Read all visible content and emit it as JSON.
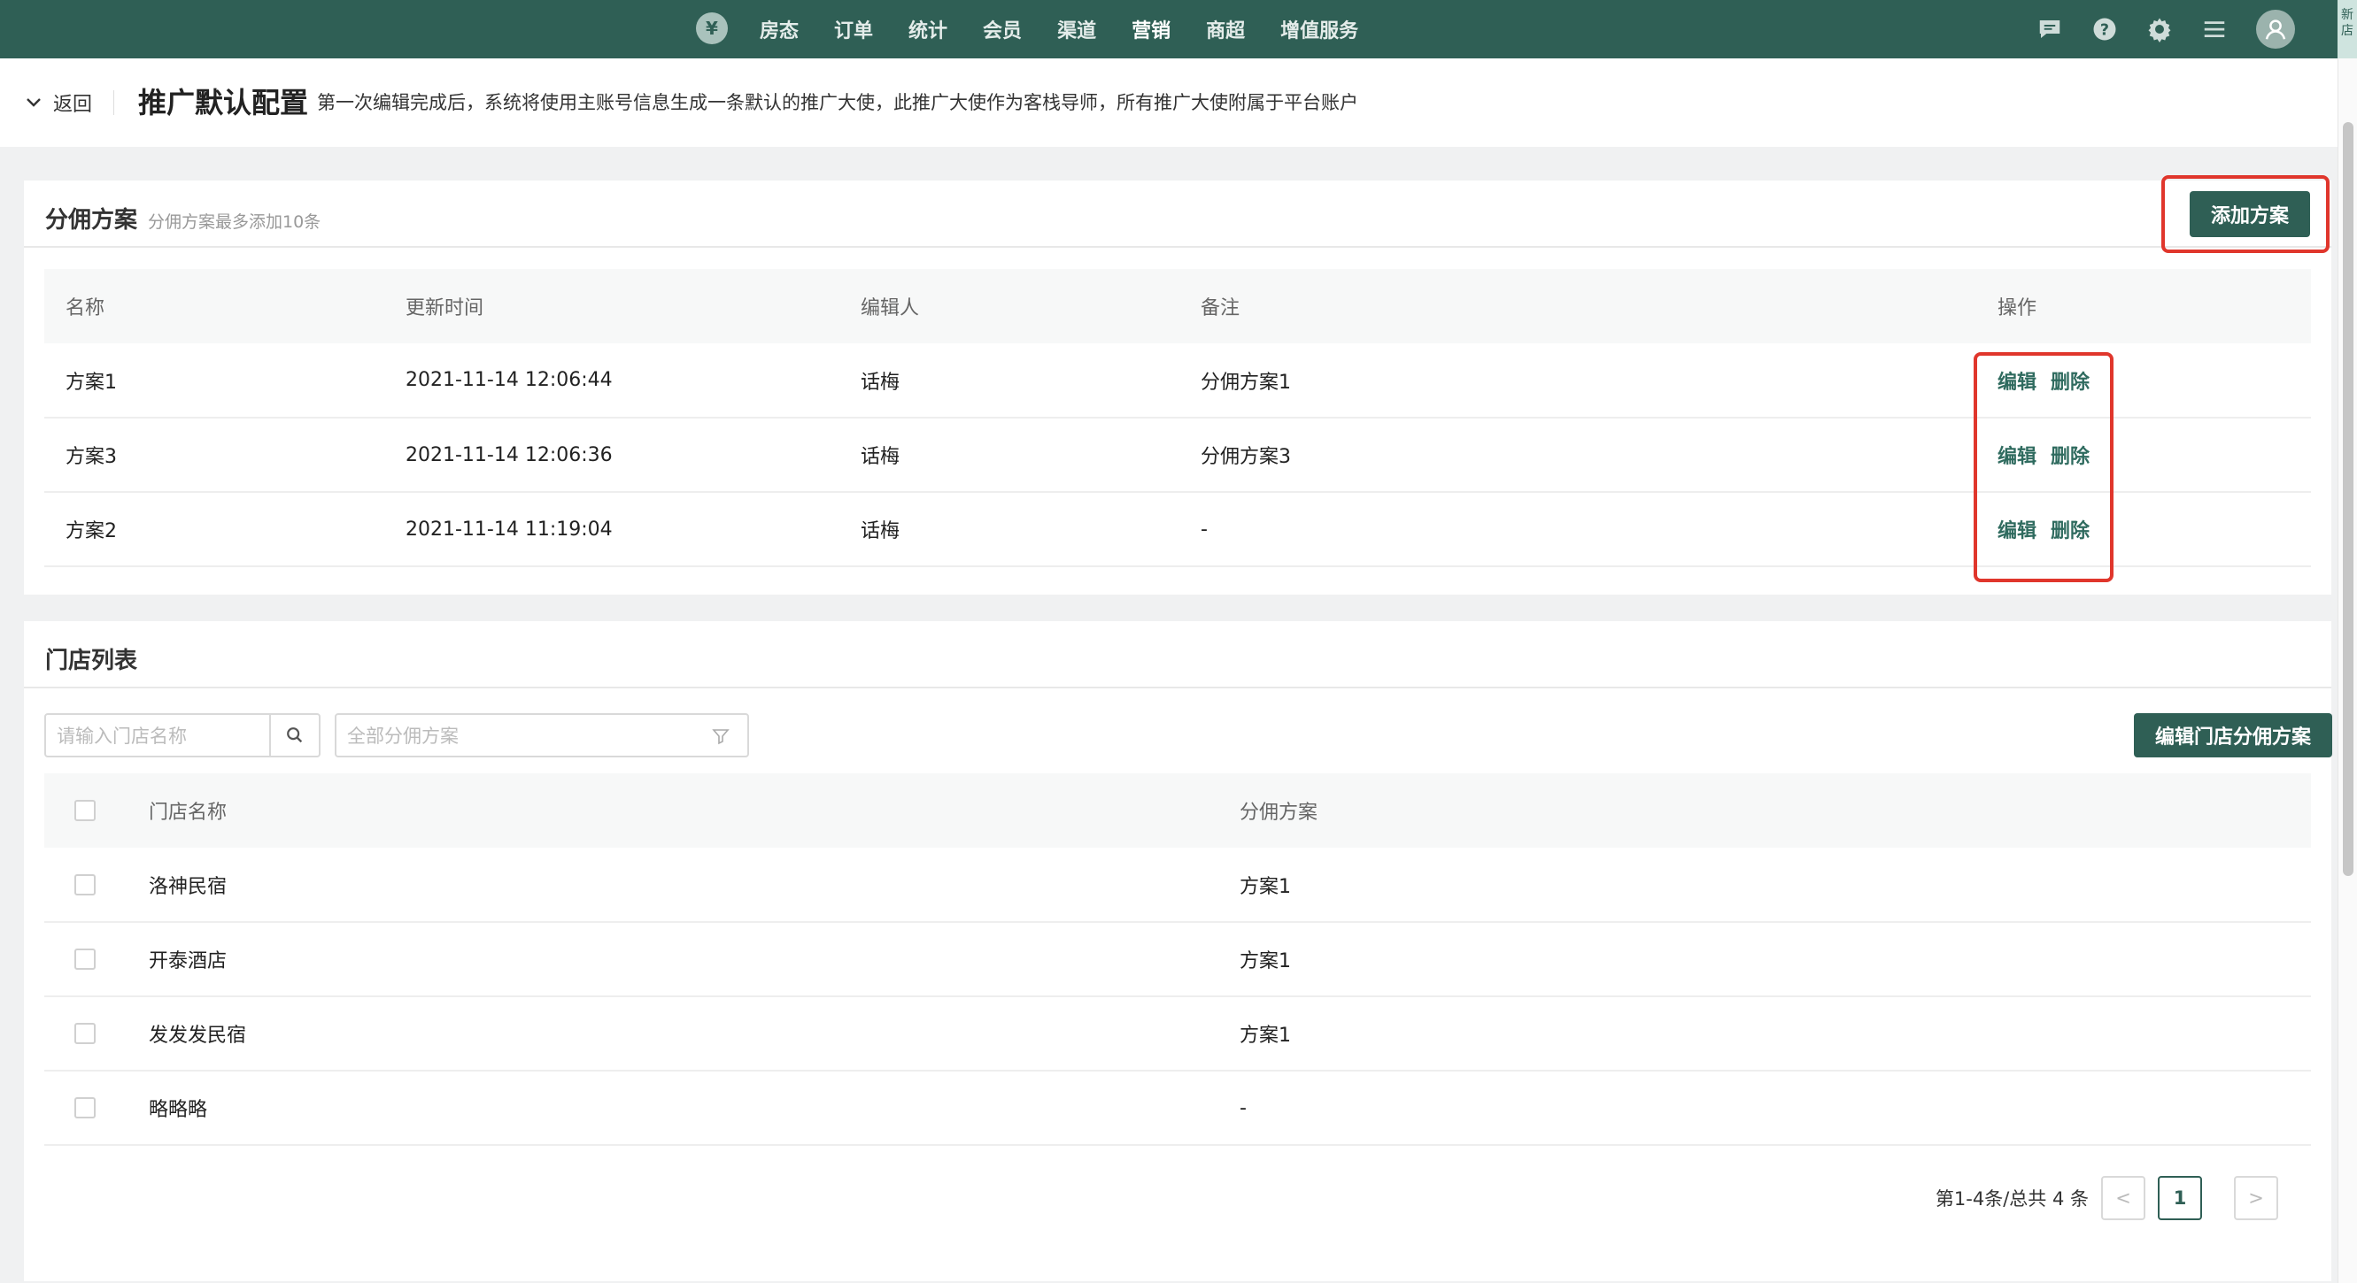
{
  "topbar": {
    "logo_glyph": "¥",
    "nav": [
      "房态",
      "订单",
      "统计",
      "会员",
      "渠道",
      "营销",
      "商超",
      "增值服务"
    ],
    "active_nav": "营销",
    "icons": [
      "message-icon",
      "help-icon",
      "settings-icon",
      "menu-icon",
      "user-avatar-icon"
    ],
    "edge_tab": "新店"
  },
  "header": {
    "back_label": "返回",
    "title": "推广默认配置",
    "description": "第一次编辑完成后，系统将使用主账号信息生成一条默认的推广大使，此推广大使作为客栈导师，所有推广大使附属于平台账户"
  },
  "plans": {
    "title": "分佣方案",
    "subtitle": "分佣方案最多添加10条",
    "add_button": "添加方案",
    "columns": [
      "名称",
      "更新时间",
      "编辑人",
      "备注",
      "操作"
    ],
    "rows": [
      {
        "name": "方案1",
        "updated": "2021-11-14 12:06:44",
        "editor": "话梅",
        "note": "分佣方案1"
      },
      {
        "name": "方案3",
        "updated": "2021-11-14 12:06:36",
        "editor": "话梅",
        "note": "分佣方案3"
      },
      {
        "name": "方案2",
        "updated": "2021-11-14 11:19:04",
        "editor": "话梅",
        "note": "-"
      }
    ],
    "edit_label": "编辑",
    "delete_label": "删除"
  },
  "stores": {
    "title": "门店列表",
    "search_placeholder": "请输入门店名称",
    "filter_placeholder": "全部分佣方案",
    "edit_button": "编辑门店分佣方案",
    "columns": [
      "门店名称",
      "分佣方案"
    ],
    "rows": [
      {
        "name": "洛神民宿",
        "plan": "方案1"
      },
      {
        "name": "开泰酒店",
        "plan": "方案1"
      },
      {
        "name": "发发发民宿",
        "plan": "方案1"
      },
      {
        "name": "略略略",
        "plan": "-"
      }
    ],
    "pagination": {
      "summary": "第1-4条/总共 4 条",
      "current_page": "1",
      "prev": "<",
      "next": ">"
    }
  },
  "colors": {
    "brand": "#2f5f55",
    "highlight": "#e0362c",
    "link": "#2f6b5f"
  }
}
